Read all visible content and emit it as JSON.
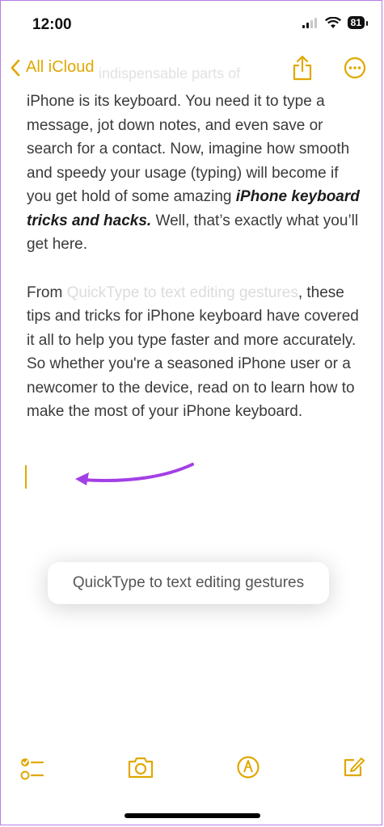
{
  "status": {
    "time": "12:00",
    "battery": "81"
  },
  "nav": {
    "back_label": "All iCloud",
    "faded_title": "indispensable parts of"
  },
  "note": {
    "p1_a": "iPhone is its keyboard. You need it to type a message, jot down notes, and even save or search for a contact. Now, imagine how smooth and speedy your usage (typing) will become if you get hold of some amazing ",
    "p1_em": "iPhone keyboard tricks and hacks.",
    "p1_b": " Well, that’s exactly what you’ll get here.",
    "p2_a": "From ",
    "p2_link": "QuickType to text editing gestures",
    "p2_b": ", these tips and tricks for iPhone keyboard have covered it all to help you type faster and more accurately. So whether you're a seasoned iPhone user or a newcomer to the device, read on to learn how to make the most of your iPhone keyboard."
  },
  "suggestion": {
    "label": "QuickType to text editing gestures"
  },
  "colors": {
    "accent": "#e0a800",
    "annotation_arrow": "#a33fe6"
  },
  "toolbar": {
    "icons": [
      "checklist-icon",
      "camera-icon",
      "markup-icon",
      "compose-icon"
    ]
  }
}
